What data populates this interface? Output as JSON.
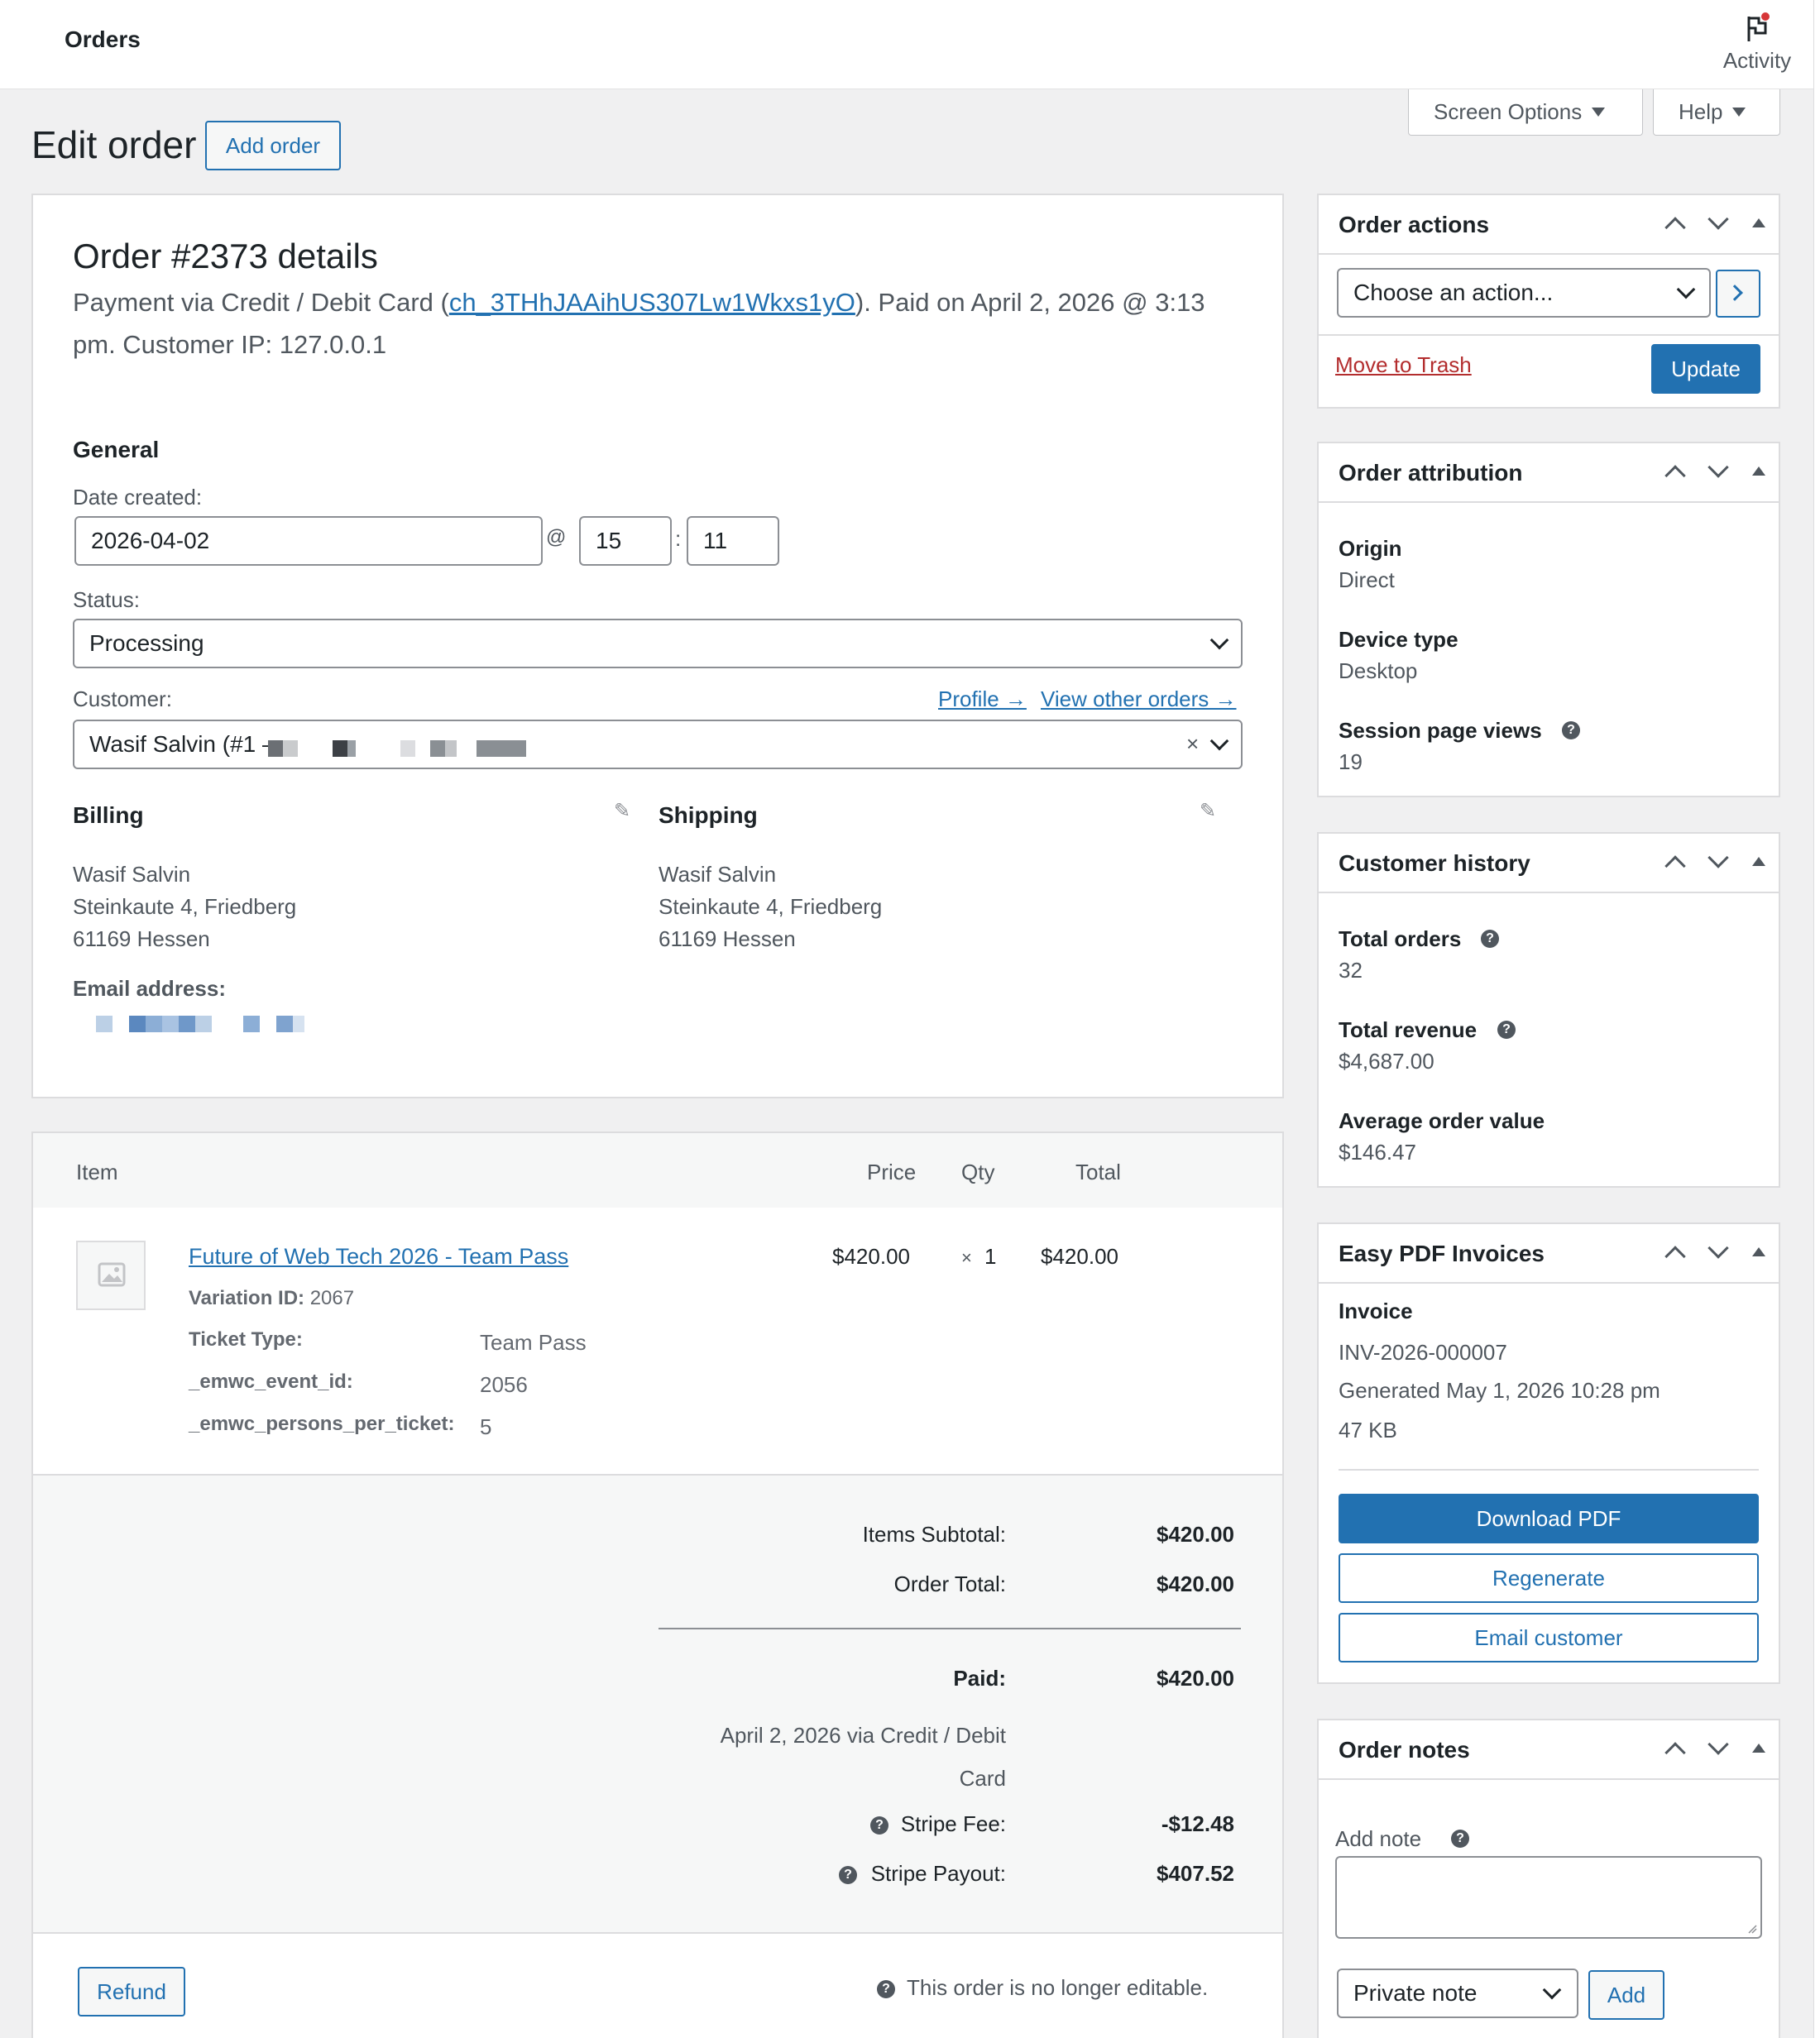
{
  "topbar": {
    "title": "Orders",
    "activity_label": "Activity"
  },
  "screen_options": {
    "label": "Screen Options"
  },
  "help_tab": {
    "label": "Help"
  },
  "page": {
    "title": "Edit order",
    "add_order_label": "Add order"
  },
  "order": {
    "heading": "Order #2373 details",
    "payment_prefix": "Payment via Credit / Debit Card (",
    "charge_id": "ch_3THhJAAihUS307Lw1Wkxs1yO",
    "payment_suffix_line1": "). Paid on April 2, 2026 @ 3:13",
    "payment_line2": "pm. Customer IP: 127.0.0.1",
    "general_label": "General",
    "date_created_label": "Date created:",
    "date": "2026-04-02",
    "at": "@",
    "hour": "15",
    "colon": ":",
    "minute": "11",
    "status_label": "Status:",
    "status": "Processing",
    "customer_label": "Customer:",
    "profile_link": "Profile →",
    "other_orders_link": "View other orders →",
    "customer_value": "Wasif Salvin (#1 –",
    "billing": {
      "title": "Billing",
      "lines": [
        "Wasif Salvin",
        "Steinkaute 4, Friedberg",
        "61169 Hessen"
      ],
      "email_label": "Email address:"
    },
    "shipping": {
      "title": "Shipping",
      "lines": [
        "Wasif Salvin",
        "Steinkaute 4, Friedberg",
        "61169 Hessen"
      ]
    }
  },
  "items": {
    "headers": {
      "item": "Item",
      "price": "Price",
      "qty": "Qty",
      "total": "Total"
    },
    "rows": [
      {
        "name": "Future of Web Tech 2026 - Team Pass",
        "variation_label": "Variation ID:",
        "variation_id": "2067",
        "meta": [
          {
            "key": "Ticket Type:",
            "value": "Team Pass"
          },
          {
            "key": "_emwc_event_id:",
            "value": "2056"
          },
          {
            "key": "_emwc_persons_per_ticket:",
            "value": "5"
          }
        ],
        "price": "$420.00",
        "qty_x": "×",
        "qty": "1",
        "total": "$420.00"
      }
    ]
  },
  "totals": {
    "subtotal_label": "Items Subtotal:",
    "subtotal": "$420.00",
    "order_total_label": "Order Total:",
    "order_total": "$420.00",
    "paid_label": "Paid:",
    "paid": "$420.00",
    "paid_note_line1": "April 2, 2026 via Credit / Debit",
    "paid_note_line2": "Card",
    "stripe_fee_label": "Stripe Fee:",
    "stripe_fee": "-$12.48",
    "stripe_payout_label": "Stripe Payout:",
    "stripe_payout": "$407.52"
  },
  "footer": {
    "refund_label": "Refund",
    "not_editable": "This order is no longer editable."
  },
  "sidebar": {
    "order_actions": {
      "title": "Order actions",
      "select": "Choose an action...",
      "trash": "Move to Trash",
      "update": "Update"
    },
    "attribution": {
      "title": "Order attribution",
      "origin_label": "Origin",
      "origin": "Direct",
      "device_label": "Device type",
      "device": "Desktop",
      "views_label": "Session page views",
      "views": "19"
    },
    "history": {
      "title": "Customer history",
      "total_orders_label": "Total orders",
      "total_orders": "32",
      "total_revenue_label": "Total revenue",
      "total_revenue": "$4,687.00",
      "avg_label": "Average order value",
      "avg": "$146.47"
    },
    "pdf": {
      "title": "Easy PDF Invoices",
      "invoice_label": "Invoice",
      "invoice_number": "INV-2026-000007",
      "generated": "Generated May 1, 2026 10:28 pm",
      "size": "47 KB",
      "download": "Download PDF",
      "regenerate": "Regenerate",
      "email": "Email customer"
    },
    "notes": {
      "title": "Order notes",
      "add_note_label": "Add note",
      "type": "Private note",
      "add": "Add"
    }
  },
  "colors": {
    "accent": "#2271b1",
    "danger": "#b32d2e",
    "border": "#dcdcde",
    "bg": "#f0f0f1"
  }
}
